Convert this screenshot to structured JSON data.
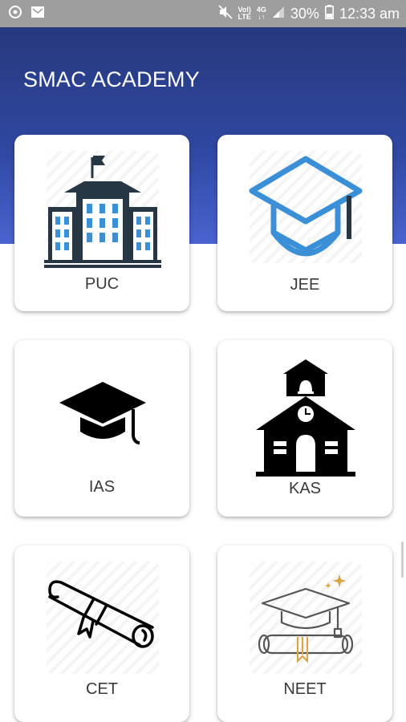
{
  "status_bar": {
    "network_top": "Vol)",
    "network_bottom": "LTE",
    "data_top": "4G",
    "data_bottom": "↓↑",
    "battery": "30%",
    "time": "12:33 am"
  },
  "app": {
    "title": "SMAC ACADEMY"
  },
  "courses": [
    {
      "label": "PUC",
      "icon": "school-building-icon"
    },
    {
      "label": "JEE",
      "icon": "graduation-cap-icon"
    },
    {
      "label": "IAS",
      "icon": "mortarboard-icon"
    },
    {
      "label": "KAS",
      "icon": "schoolhouse-icon"
    },
    {
      "label": "CET",
      "icon": "diploma-scroll-icon"
    },
    {
      "label": "NEET",
      "icon": "graduation-diploma-icon"
    }
  ],
  "colors": {
    "header_top": "#27397d",
    "header_bottom": "#4a63cf",
    "accent_blue": "#3a8fd6"
  }
}
